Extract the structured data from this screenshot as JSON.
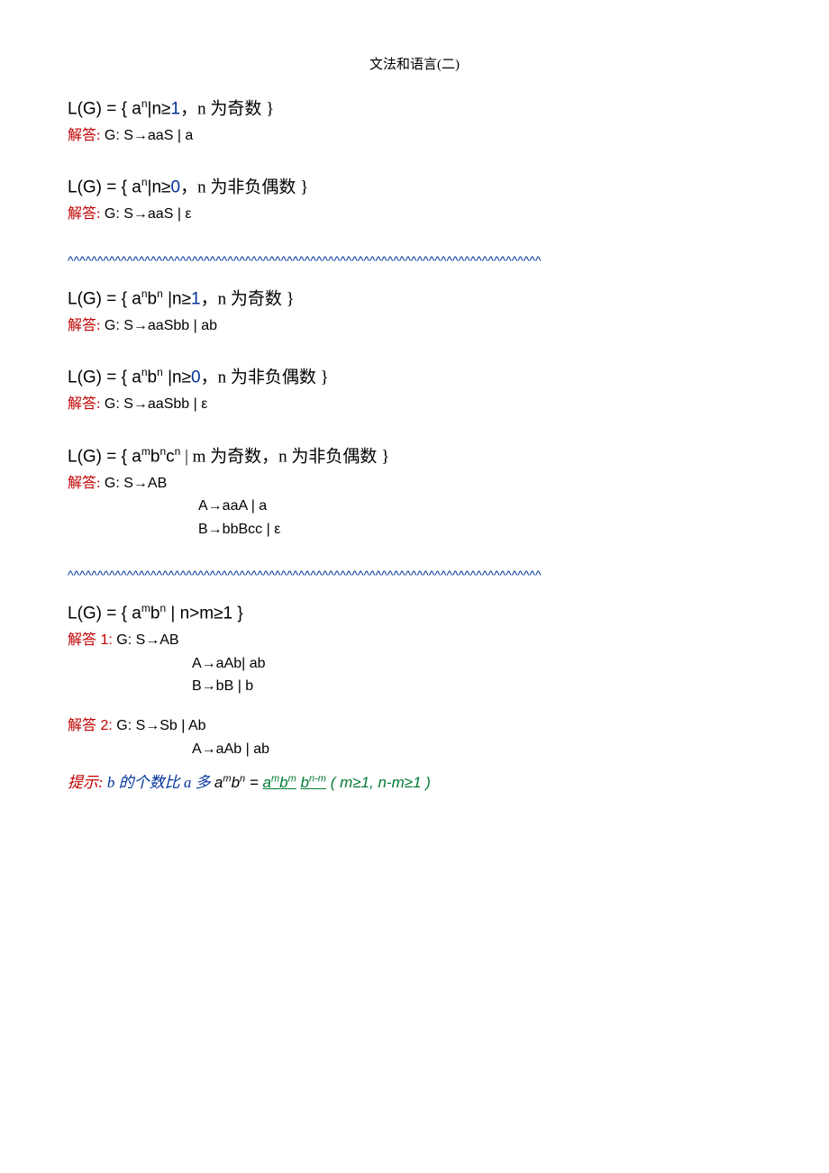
{
  "title": "文法和语言(二)",
  "sep": "^^^^^^^^^^^^^^^^^^^^^^^^^^^^^^^^^^^^^^^^^^^^^^^^^^^^^^^^^^^^^^^^^^^^^^^^^^^^^^^^",
  "p1": {
    "lg_pre": "L(G) = { a",
    "lg_sup": "n",
    "lg_mid": "|n≥",
    "lg_num": "1",
    "lg_cn": "，n 为奇数 }",
    "ans_label": "解答:",
    "ans_text": "   G:  S→aaS | a"
  },
  "p2": {
    "lg_pre": "L(G) = { a",
    "lg_sup": "n",
    "lg_mid": "|n≥",
    "lg_num": "0",
    "lg_cn": "，n 为非负偶数 }",
    "ans_label": "解答:",
    "ans_text": "   G:  S→aaS | ε"
  },
  "p3": {
    "lg_pre": "L(G) = { a",
    "lg_sup1": "n",
    "lg_b": "b",
    "lg_sup2": "n",
    "lg_mid": " |n≥",
    "lg_num": "1",
    "lg_cn": "，n 为奇数 }",
    "ans_label": "解答:",
    "ans_text": "   G:  S→aaSbb | ab"
  },
  "p4": {
    "lg_pre": "L(G) = { a",
    "lg_sup1": "n",
    "lg_b": "b",
    "lg_sup2": "n",
    "lg_mid": " |n≥",
    "lg_num": "0",
    "lg_cn": "，n 为非负偶数 }",
    "ans_label": "解答:",
    "ans_text": "   G:  S→aaSbb | ε"
  },
  "p5": {
    "lg_pre": "L(G) = { a",
    "lg_sup1": "m",
    "lg_b": "b",
    "lg_sup2": "n",
    "lg_c": "c",
    "lg_sup3": "n",
    "lg_cn": " | m 为奇数，n 为非负偶数 }",
    "ans_label": "解答:",
    "ans_text": "   G:  S→AB",
    "line2": "A→aaA | a",
    "line3": "B→bbBcc | ε"
  },
  "p6": {
    "lg_pre": "L(G) = { a",
    "lg_sup1": "m",
    "lg_b": "b",
    "lg_sup2": "n",
    "lg_rest": " | n>m≥1 }",
    "ans1_label": "解答",
    "ans1_num": " 1: ",
    "ans1_text": "G:  S→AB",
    "ans1_line2": "A→aAb| ab",
    "ans1_line3": "B→bB | b",
    "ans2_label": "解答",
    "ans2_num": " 2: ",
    "ans2_text": "G:  S→Sb | Ab",
    "ans2_line2": "A→aAb | ab"
  },
  "hint": {
    "label": "提示:   ",
    "text": "b 的个数比 a 多    ",
    "f_a": "a",
    "f_m": "m",
    "f_b": "b",
    "f_n": "n",
    "eq": " = ",
    "u1_a": "a",
    "u1_m": "m",
    "u1_b": "b",
    "u1_m2": "m",
    "sp": "   ",
    "u2_b": "b",
    "u2_nm": "n-m",
    "paren": "   ( m≥1, n-m≥1 )"
  }
}
